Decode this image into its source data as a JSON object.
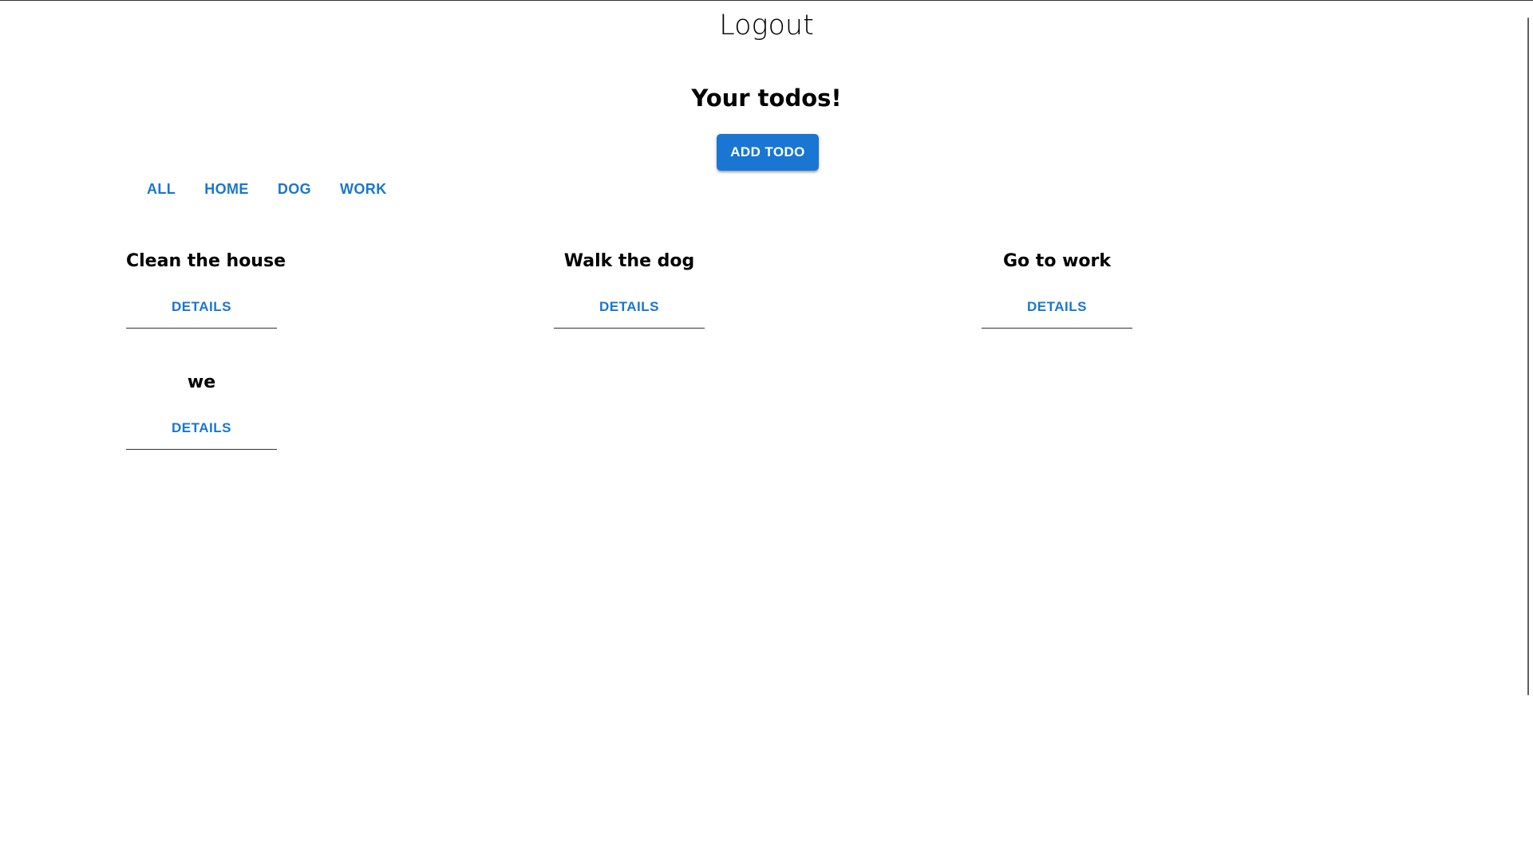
{
  "header": {
    "logout_label": "Logout"
  },
  "main": {
    "title": "Your todos!",
    "add_button_label": "ADD TODO",
    "filters": [
      {
        "label": "ALL"
      },
      {
        "label": "HOME"
      },
      {
        "label": "DOG"
      },
      {
        "label": "WORK"
      }
    ],
    "todos": [
      {
        "title": "Clean the house",
        "details_label": "DETAILS"
      },
      {
        "title": "Walk the dog",
        "details_label": "DETAILS"
      },
      {
        "title": "Go to work",
        "details_label": "DETAILS"
      },
      {
        "title": "we",
        "details_label": "DETAILS"
      }
    ]
  },
  "colors": {
    "primary": "#1976d2",
    "text": "#000000",
    "divider": "#333333",
    "background": "#ffffff"
  }
}
